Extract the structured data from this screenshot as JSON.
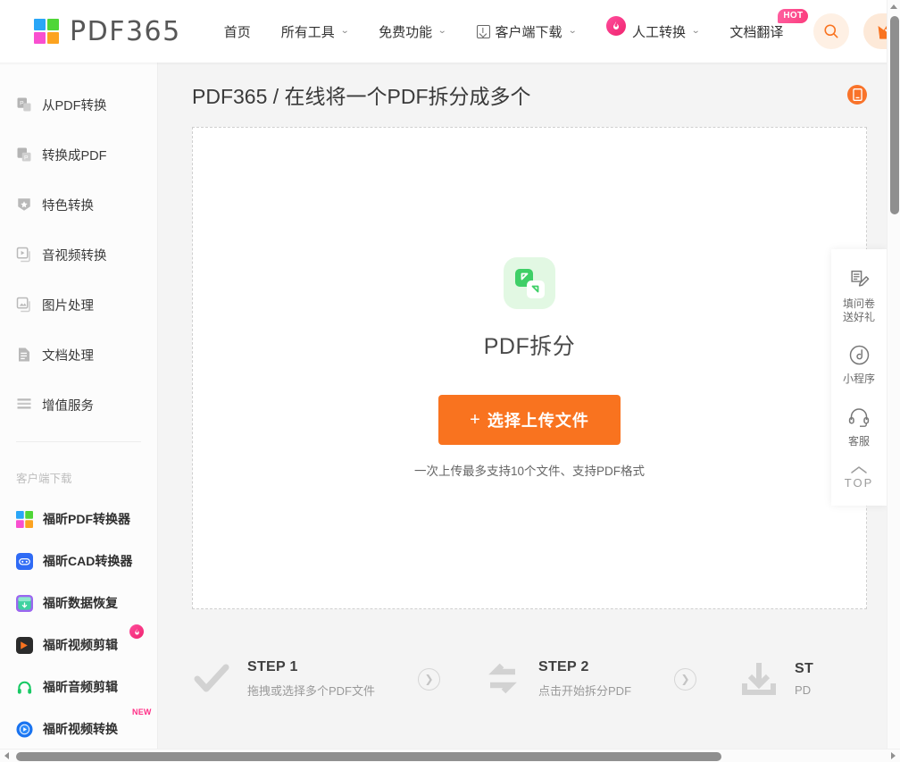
{
  "header": {
    "logo_text": "PDF365",
    "logo_colors": [
      "#29a6f7",
      "#4fd637",
      "#f94fd0",
      "#fca320"
    ],
    "nav": [
      {
        "label": "首页",
        "caret": false,
        "icon": "none",
        "badge": ""
      },
      {
        "label": "所有工具",
        "caret": true,
        "icon": "none",
        "badge": ""
      },
      {
        "label": "免费功能",
        "caret": true,
        "icon": "none",
        "badge": ""
      },
      {
        "label": "客户端下载",
        "caret": true,
        "icon": "download-box-icon",
        "badge": ""
      },
      {
        "label": "人工转换",
        "caret": true,
        "icon": "flame-icon",
        "badge": ""
      },
      {
        "label": "文档翻译",
        "caret": false,
        "icon": "none",
        "badge": "HOT"
      }
    ],
    "search_icon": "search-icon",
    "vip_icon": "crown-icon"
  },
  "sidebar": {
    "items": [
      {
        "label": "从PDF转换",
        "icon": "from-pdf-icon"
      },
      {
        "label": "转换成PDF",
        "icon": "to-pdf-icon"
      },
      {
        "label": "特色转换",
        "icon": "star-shield-icon"
      },
      {
        "label": "音视频转换",
        "icon": "media-icon"
      },
      {
        "label": "图片处理",
        "icon": "image-icon"
      },
      {
        "label": "文档处理",
        "icon": "document-icon"
      },
      {
        "label": "增值服务",
        "icon": "list-icon"
      }
    ],
    "section_title": "客户端下载",
    "apps": [
      {
        "label": "福昕PDF转换器",
        "icon": "pdf365-app-icon",
        "badge": ""
      },
      {
        "label": "福昕CAD转换器",
        "icon": "cad-app-icon",
        "badge": ""
      },
      {
        "label": "福昕数据恢复",
        "icon": "data-recovery-app-icon",
        "badge": ""
      },
      {
        "label": "福昕视频剪辑",
        "icon": "video-edit-app-icon",
        "badge": "flame"
      },
      {
        "label": "福昕音频剪辑",
        "icon": "audio-edit-app-icon",
        "badge": ""
      },
      {
        "label": "福昕视频转换",
        "icon": "video-convert-app-icon",
        "badge": "NEW"
      }
    ]
  },
  "main": {
    "page_title": "PDF365 / 在线将一个PDF拆分成多个",
    "mobile_icon": "mobile-app-icon",
    "tool_icon": "split-icon",
    "tool_name": "PDF拆分",
    "upload_button": "选择上传文件",
    "upload_plus": "+",
    "upload_hint": "一次上传最多支持10个文件、支持PDF格式",
    "accent_color": "#f9731f"
  },
  "steps": [
    {
      "title": "STEP 1",
      "desc": "拖拽或选择多个PDF文件",
      "icon": "check-icon"
    },
    {
      "title": "STEP 2",
      "desc": "点击开始拆分PDF",
      "icon": "swap-arrows-icon"
    },
    {
      "title": "ST",
      "desc": "PD",
      "icon": "download-icon"
    }
  ],
  "dock": [
    {
      "label": "填问卷\n送好礼",
      "icon": "survey-icon"
    },
    {
      "label": "小程序",
      "icon": "miniprogram-icon"
    },
    {
      "label": "客服",
      "icon": "headset-icon"
    },
    {
      "label": "TOP",
      "icon": "chevron-up-icon"
    }
  ]
}
